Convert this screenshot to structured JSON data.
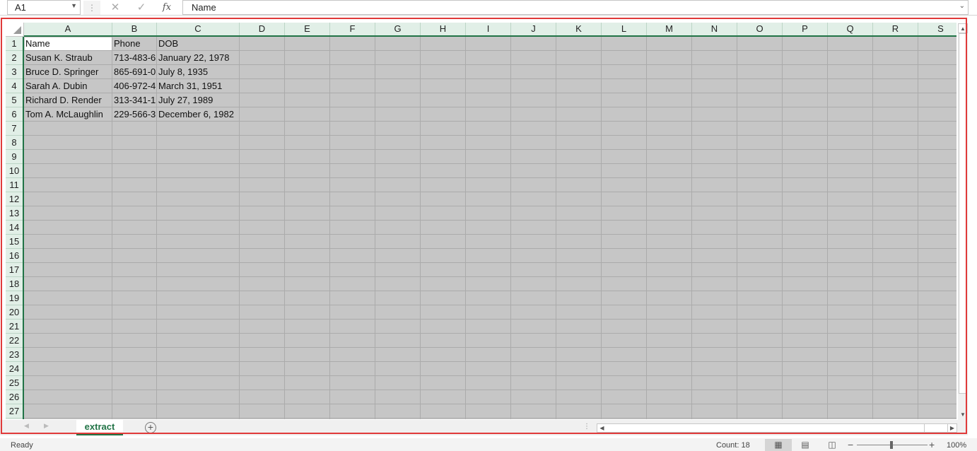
{
  "formula_bar": {
    "name_box": "A1",
    "cancel_icon": "close-icon",
    "enter_icon": "check-icon",
    "fx_label": "fx",
    "formula_value": "Name"
  },
  "columns": [
    "A",
    "B",
    "C",
    "D",
    "E",
    "F",
    "G",
    "H",
    "I",
    "J",
    "K",
    "L",
    "M",
    "N",
    "O",
    "P",
    "Q",
    "R",
    "S"
  ],
  "rows": [
    "1",
    "2",
    "3",
    "4",
    "5",
    "6",
    "7",
    "8",
    "9",
    "10",
    "11",
    "12",
    "13",
    "14",
    "15",
    "16",
    "17",
    "18",
    "19",
    "20",
    "21",
    "22",
    "23",
    "24",
    "25",
    "26",
    "27"
  ],
  "table": {
    "headers": [
      "Name",
      "Phone",
      "DOB"
    ],
    "rows": [
      [
        "Susan K. Straub",
        "713-483-6",
        "January 22, 1978"
      ],
      [
        "Bruce D. Springer",
        "865-691-0",
        "July 8, 1935"
      ],
      [
        "Sarah A. Dubin",
        "406-972-4",
        "March 31, 1951"
      ],
      [
        "Richard D. Render",
        "313-341-1",
        "July 27, 1989"
      ],
      [
        "Tom A. McLaughlin",
        "229-566-3",
        "December 6, 1982"
      ]
    ]
  },
  "sheet_tabs": [
    "extract"
  ],
  "status_bar": {
    "status": "Ready",
    "count": "Count: 18",
    "zoom": "100%"
  },
  "colors": {
    "accent": "#217346",
    "highlight": "#e03a3a",
    "selection_fill": "#c6c6c6"
  }
}
